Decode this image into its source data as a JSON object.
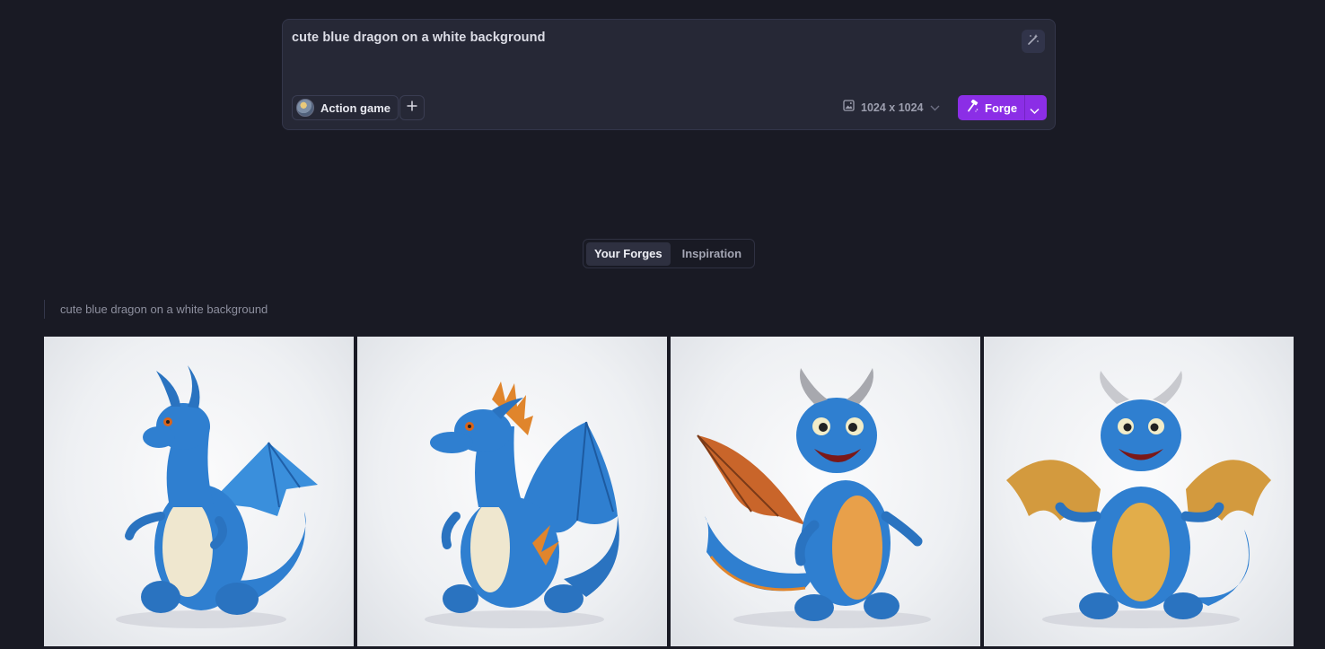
{
  "prompt": {
    "text": "cute blue dragon on a white background",
    "magic_icon": "magic-wand-icon"
  },
  "toolbar": {
    "style_label": "Action game",
    "add_icon": "plus-icon",
    "size_label": "1024 x 1024",
    "size_icon": "image-icon",
    "forge_label": "Forge",
    "forge_icon": "hammer-icon"
  },
  "tabs": [
    {
      "label": "Your Forges",
      "active": true
    },
    {
      "label": "Inspiration",
      "active": false
    }
  ],
  "gallery": {
    "prompt_label": "cute blue dragon on a white background",
    "images": [
      {
        "subject": "blue dragon, blue wings"
      },
      {
        "subject": "blue dragon with orange spikes"
      },
      {
        "subject": "blue dragon, orange wings, horns"
      },
      {
        "subject": "blue dragon, golden wings, horns"
      }
    ]
  },
  "colors": {
    "background": "#191a24",
    "panel": "#262836",
    "accent": "#8b2ee6",
    "dragon_blue": "#2f7fd0"
  }
}
